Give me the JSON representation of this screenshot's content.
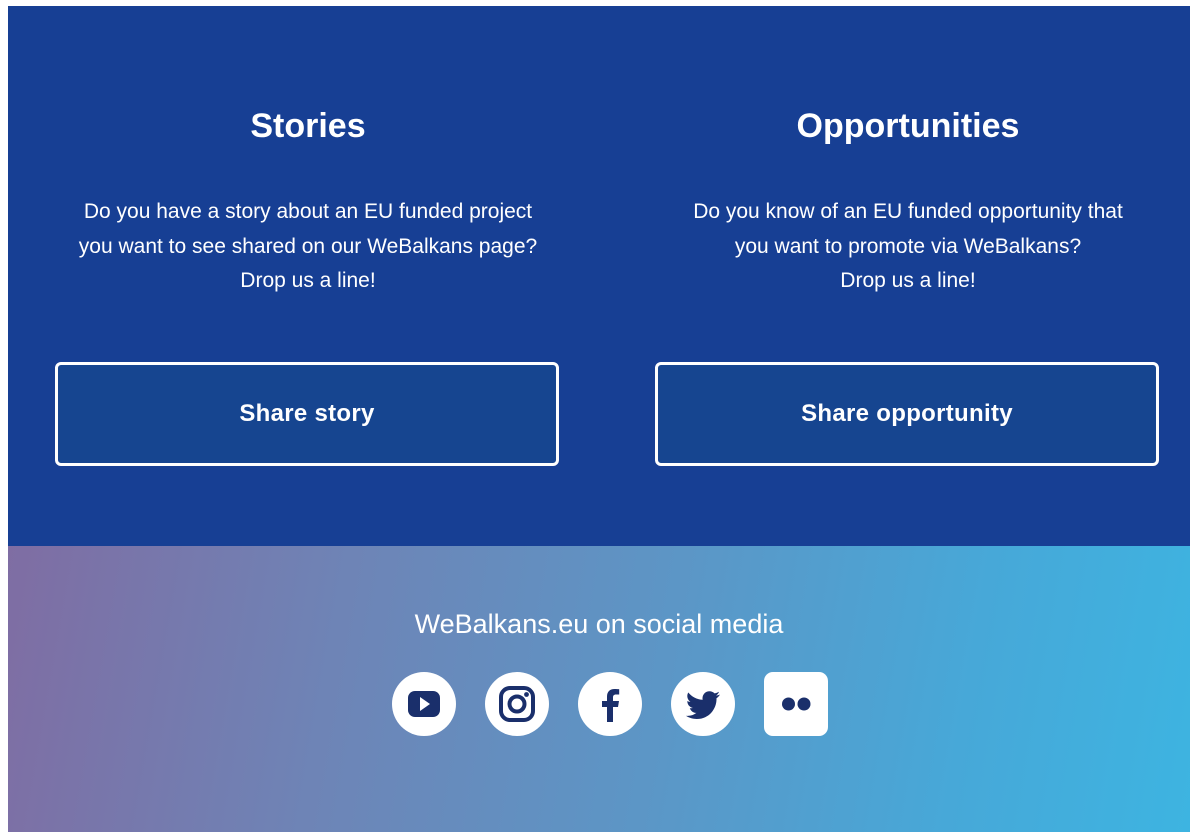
{
  "stories": {
    "title": "Stories",
    "text_lines": [
      "Do you have a story about an EU funded project",
      "you want to see shared on our WeBalkans page?",
      "Drop us a line!"
    ],
    "button_label": "Share story"
  },
  "opportunities": {
    "title": "Opportunities",
    "text_lines": [
      "Do you know of an EU funded opportunity that",
      "you want to promote via WeBalkans?",
      "Drop us a line!"
    ],
    "button_label": "Share opportunity"
  },
  "social": {
    "title": "WeBalkans.eu on social media",
    "icons": [
      "youtube-icon",
      "instagram-icon",
      "facebook-icon",
      "twitter-icon",
      "flickr-icon"
    ]
  },
  "colors": {
    "cta_background": "#173f94",
    "button_background": "#164590",
    "gradient_start": "#7f6da3",
    "gradient_end": "#3db4e1"
  }
}
